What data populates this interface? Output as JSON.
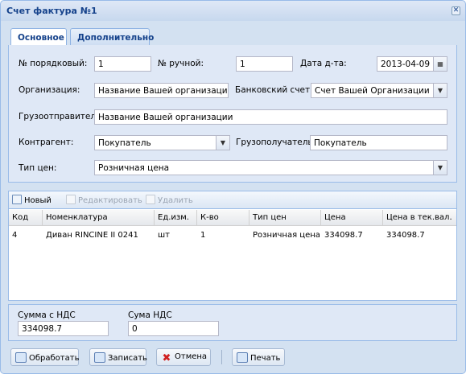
{
  "window": {
    "title": "Счет фактура №1",
    "close_glyph": "✕"
  },
  "tabs": [
    {
      "label": "Основное"
    },
    {
      "label": "Дополнительно"
    }
  ],
  "form": {
    "order_no_label": "№ порядковый:",
    "order_no_value": "1",
    "manual_no_label": "№ ручной:",
    "manual_no_value": "1",
    "date_label": "Дата д-та:",
    "date_value": "2013-04-09",
    "org_label": "Организация:",
    "org_value": "Название Вашей организации",
    "bank_label": "Банковский счет:",
    "bank_value": "Счет Вашей Организации",
    "shipper_label": "Грузоотправитель:",
    "shipper_value": "Название Вашей организации",
    "counterparty_label": "Контрагент:",
    "counterparty_value": "Покупатель",
    "consignee_label": "Грузополучатель:",
    "consignee_value": "Покупатель",
    "price_type_label": "Тип цен:",
    "price_type_value": "Розничная цена"
  },
  "grid": {
    "toolbar": {
      "new_label": "Новый",
      "edit_label": "Редактировать",
      "delete_label": "Удалить"
    },
    "columns": [
      "Код",
      "Номенклатура",
      "Ед.изм.",
      "К-во",
      "Тип цен",
      "Цена",
      "Цена в тек.вал."
    ],
    "rows": [
      [
        "4",
        "Диван RINCINE II 0241",
        "шт",
        "1",
        "Розничная цена",
        "334098.7",
        "334098.7"
      ]
    ]
  },
  "totals": {
    "sum_vat_label": "Сумма с НДС",
    "sum_vat_value": "334098.7",
    "vat_label": "Сума НДС",
    "vat_value": "0"
  },
  "buttons": {
    "process_label": "Обработать",
    "save_label": "Записать",
    "cancel_label": "Отмена",
    "print_label": "Печать"
  },
  "colors": {
    "window_bg": "#d3e1f1",
    "title_text": "#15428b",
    "border": "#99bbe8",
    "cancel_icon": "#d02020"
  }
}
